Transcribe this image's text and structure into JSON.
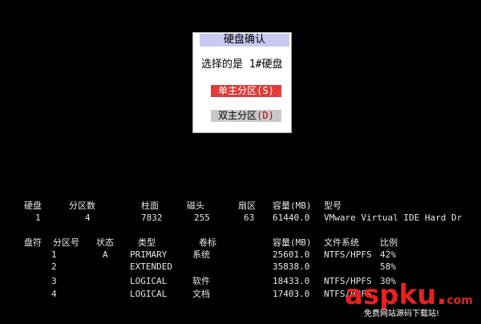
{
  "dialog": {
    "title": "硬盘确认",
    "prompt": "选择的是 1#硬盘",
    "single_label": "单主分区",
    "single_hotkey": "(S)",
    "dual_label": "双主分区",
    "dual_hotkey": "(D)"
  },
  "disk_table": {
    "headers": [
      "硬盘",
      "分区数",
      "柱面",
      "磁头",
      "扇区",
      "容量(MB)",
      "型号"
    ],
    "row": [
      "1",
      "4",
      "7832",
      "255",
      "63",
      "61440.0",
      "VMware Virtual IDE Hard Dr"
    ]
  },
  "partition_table": {
    "headers": [
      "盘符",
      "分区号",
      "状态",
      "类型",
      "卷标",
      "容量(MB)",
      "文件系统",
      "比例"
    ],
    "rows": [
      [
        "",
        "1",
        "A",
        "PRIMARY",
        "系统",
        "25601.0",
        "NTFS/HPFS",
        "42%"
      ],
      [
        "",
        "2",
        "",
        "EXTENDED",
        "",
        "35838.0",
        "",
        "58%"
      ],
      [
        "",
        "3",
        "",
        "LOGICAL",
        "软件",
        "18433.0",
        "NTFS/HPFS",
        "30%"
      ],
      [
        "",
        "4",
        "",
        "LOGICAL",
        "文档",
        "17403.0",
        "NTFS/HPFS",
        ""
      ]
    ]
  },
  "watermark": {
    "logo_asp": "asp",
    "logo_ku": "ku",
    "logo_dot": ".",
    "logo_com": "com",
    "subtitle": "免费网站源码下载站!"
  }
}
